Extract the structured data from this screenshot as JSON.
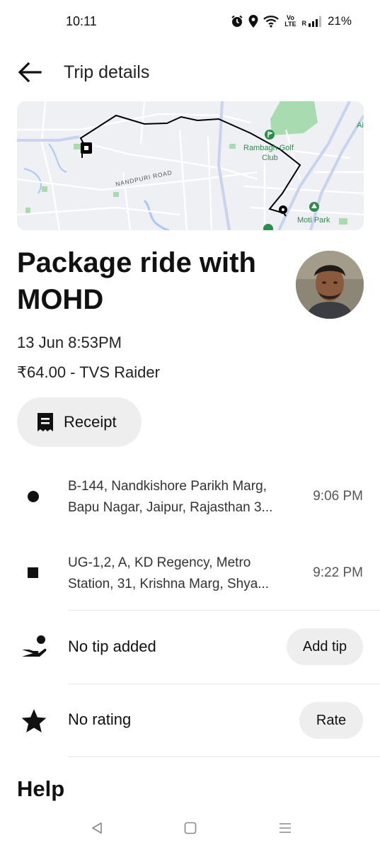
{
  "status_bar": {
    "time": "10:11",
    "network_label": "Vo LTE",
    "roaming_label": "R",
    "battery": "21%",
    "icons": [
      "alarm-icon",
      "location-icon",
      "wifi-icon",
      "volte-icon",
      "signal-icon"
    ]
  },
  "header": {
    "title": "Trip details",
    "back_icon": "arrow-left-icon"
  },
  "map": {
    "labels": {
      "road": "NANDPURI ROAD",
      "poi1": "Rambagh Golf Club",
      "poi1_line1": "Rambagh Golf",
      "poi1_line2": "Club",
      "poi2": "Moti Park",
      "edge": "Ai"
    },
    "colors": {
      "background": "#eef0f4",
      "roads": "#ffffff",
      "major_roads": "#c9d3ee",
      "parks": "#a8dcb0",
      "water": "#a9c8f5",
      "route": "#000000",
      "poi": "#2e8b4e"
    }
  },
  "ride": {
    "title": "Package ride with MOHD",
    "title_line1": "Package ride with",
    "title_line2": "MOHD",
    "date": "13 Jun 8:53PM",
    "fare": "₹64.00 - TVS Raider"
  },
  "receipt": {
    "label": "Receipt",
    "icon": "receipt-icon"
  },
  "stops": [
    {
      "marker": "circle",
      "address": "B-144, Nandkishore Parikh Marg, Bapu Nagar, Jaipur, Rajasthan 3...",
      "line1": "B-144, Nandkishore Parikh Marg,",
      "line2": "Bapu Nagar, Jaipur, Rajasthan 3...",
      "time": "9:06 PM"
    },
    {
      "marker": "square",
      "address": "UG-1,2, A, KD Regency, Metro Station, 31, Krishna Marg, Shya...",
      "line1": "UG-1,2, A, KD Regency, Metro",
      "line2": "Station, 31, Krishna Marg, Shya...",
      "time": "9:22 PM"
    }
  ],
  "tip": {
    "label": "No tip added",
    "button": "Add tip",
    "icon": "hand-coin-icon"
  },
  "rating": {
    "label": "No rating",
    "button": "Rate",
    "icon": "star-icon"
  },
  "help": {
    "title": "Help"
  },
  "nav": {
    "icons": [
      "back-triangle-icon",
      "home-square-icon",
      "recents-menu-icon"
    ]
  }
}
